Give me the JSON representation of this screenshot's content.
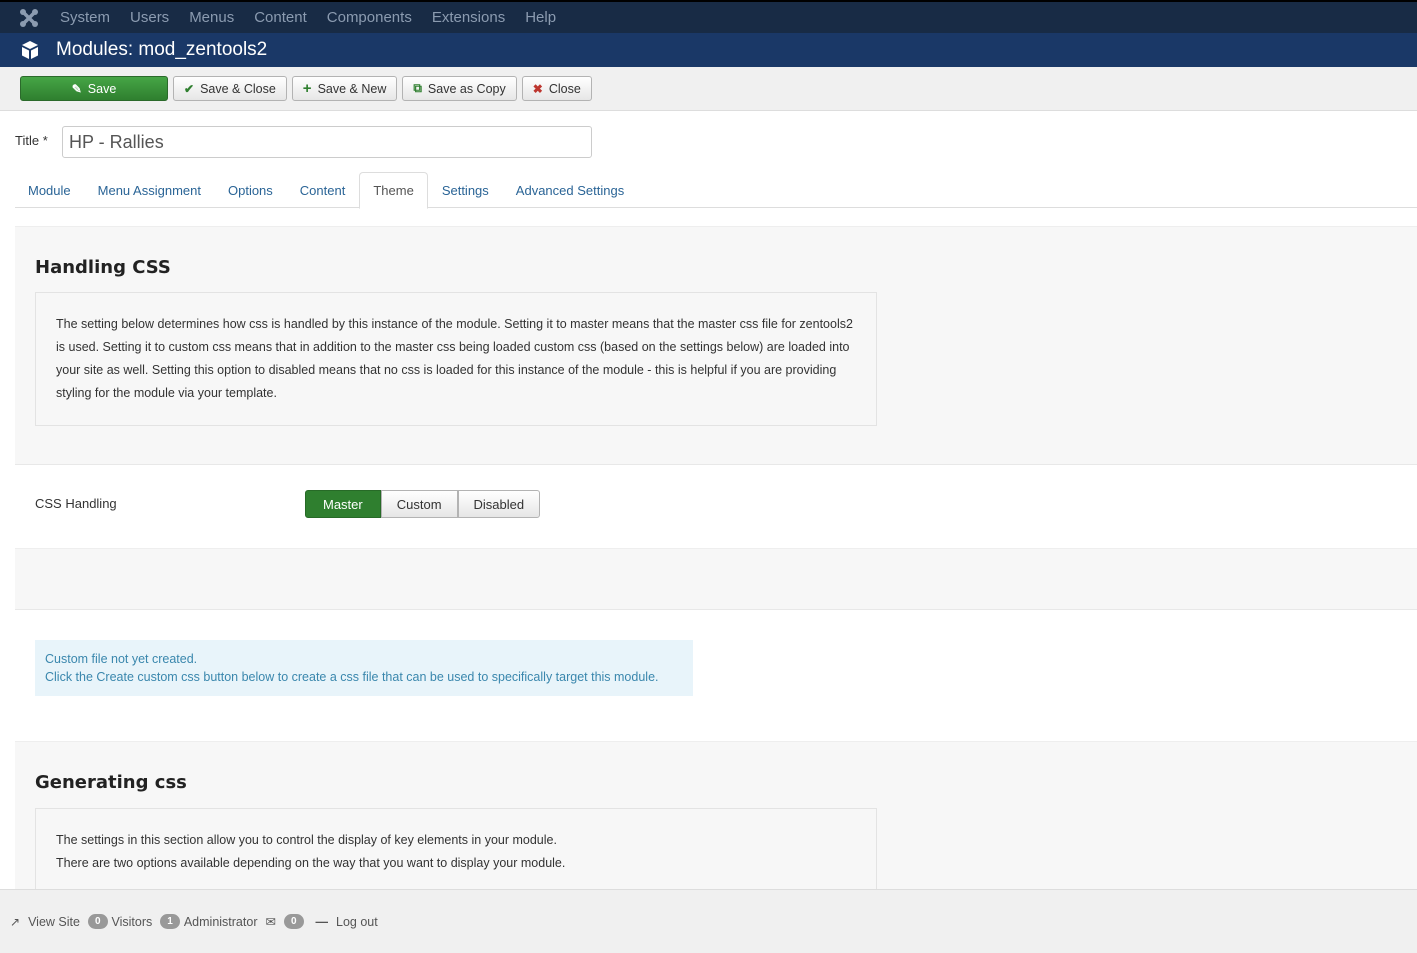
{
  "topnav": {
    "logo_icon": "joomla-logo-icon",
    "items": [
      "System",
      "Users",
      "Menus",
      "Content",
      "Components",
      "Extensions",
      "Help"
    ]
  },
  "header": {
    "icon": "cube-icon",
    "title": "Modules: mod_zentools2"
  },
  "toolbar": {
    "save": "Save",
    "save_close": "Save & Close",
    "save_new": "Save & New",
    "save_copy": "Save as Copy",
    "close": "Close"
  },
  "title_field": {
    "label": "Title *",
    "value": "HP - Rallies"
  },
  "tabs": [
    "Module",
    "Menu Assignment",
    "Options",
    "Content",
    "Theme",
    "Settings",
    "Advanced Settings"
  ],
  "active_tab": "Theme",
  "handling_css": {
    "heading": "Handling CSS",
    "description": "The setting below determines how css is handled by this instance of the module. Setting it to master means that the master css file for zentools2 is used. Setting it to custom css means that in addition to the master css being loaded custom css (based on the settings below) are loaded into your site as well. Setting this option to disabled means that no css is loaded for this instance of the module - this is helpful if you are providing styling for the module via your template."
  },
  "css_handling": {
    "label": "CSS Handling",
    "options": [
      "Master",
      "Custom",
      "Disabled"
    ],
    "selected": "Master"
  },
  "alert": {
    "line1": "Custom file not yet created.",
    "line2": "Click the Create custom css button below to create a css file that can be used to specifically target this module."
  },
  "generating_css": {
    "heading": "Generating css",
    "line1": "The settings in this section allow you to control the display of key elements in your module.",
    "line2": "There are two options available depending on the way that you want to display your module."
  },
  "footer": {
    "view_site": "View Site",
    "visitors_count": "0",
    "visitors": "Visitors",
    "admin_count": "1",
    "admin": "Administrator",
    "messages_count": "0",
    "logout": "Log out"
  },
  "colors": {
    "nav_bg": "#182b45",
    "header_bg": "#1a3867",
    "save_green": "#2f7f2f",
    "link_blue": "#2a6496",
    "alert_bg": "#e8f4fa"
  }
}
